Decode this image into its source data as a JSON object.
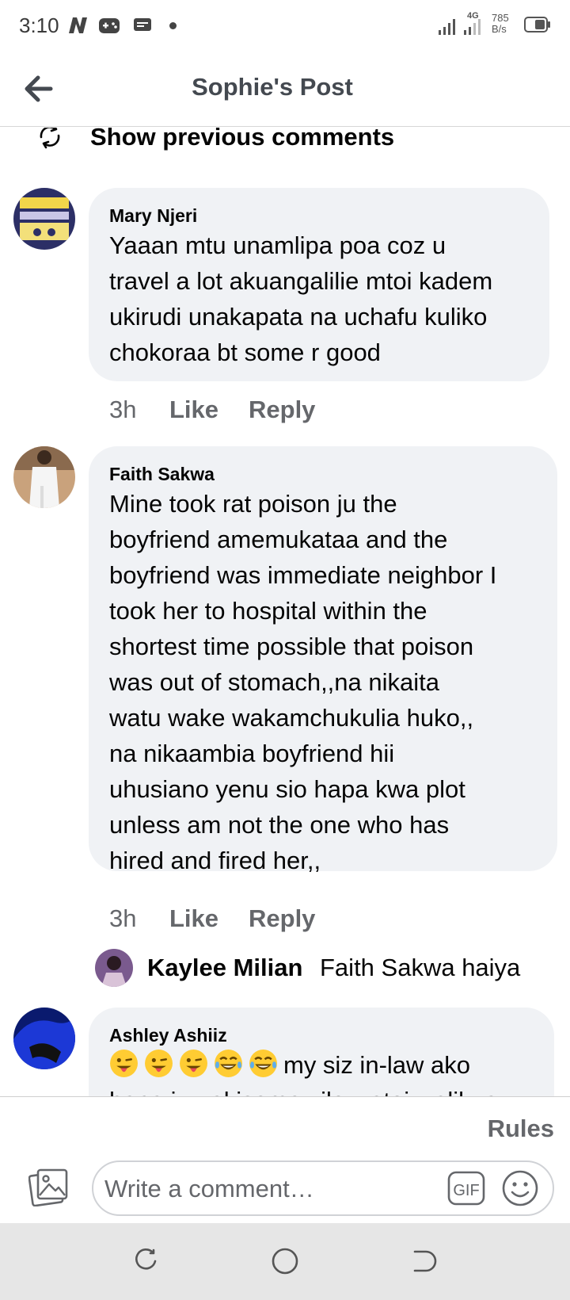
{
  "status_bar": {
    "time": "3:10",
    "network_label": "4G",
    "speed_value": "785",
    "speed_unit": "B/s",
    "icons": [
      "netflix-n-icon",
      "gamepad-icon",
      "message-icon",
      "dot-icon",
      "signal-icon",
      "signal-icon",
      "battery-icon"
    ]
  },
  "header": {
    "title": "Sophie's Post",
    "back_icon": "back-arrow-icon"
  },
  "show_previous": {
    "label": "Show previous comments",
    "icon": "refresh-icon"
  },
  "comments": [
    {
      "author": "Mary Njeri",
      "lines": [
        "Yaaan mtu unamlipa poa coz u",
        "travel a lot akuangalilie mtoi kadem",
        "ukirudi unakapata na uchafu kuliko",
        "chokoraa bt some r good"
      ],
      "time": "3h",
      "like": "Like",
      "reply": "Reply"
    },
    {
      "author": "Faith Sakwa",
      "lines": [
        "Mine took rat poison ju the",
        "boyfriend amemukataa and the",
        "boyfriend was immediate neighbor I",
        "took her to hospital within the",
        "shortest time possible that poison",
        "was out of stomach,,na nikaita",
        "watu wake  wakamchukulia huko,,",
        "na nikaambia boyfriend hii",
        "uhusiano yenu sio hapa kwa plot",
        "unless am not the one who has",
        "hired and fired her,,"
      ],
      "time": "3h",
      "like": "Like",
      "reply": "Reply",
      "reply_preview": {
        "author": "Kaylee Milian",
        "text": "Faith Sakwa haiya"
      }
    },
    {
      "author": "Ashley Ashiiz",
      "emojis": [
        "tongue-wink-emoji",
        "tongue-wink-emoji",
        "tongue-wink-emoji",
        "tears-of-joy-emoji",
        "tears-of-joy-emoji"
      ],
      "lines": [
        "my siz in-law ako",
        "hapa juu akisema vile watoi walikua"
      ]
    }
  ],
  "composer": {
    "rules_label": "Rules",
    "placeholder": "Write a comment…",
    "gif_label": "GIF",
    "photo_icon": "photo-icon",
    "emoji_icon": "emoji-smile-icon"
  },
  "nav": {
    "icons": [
      "recent-apps-icon",
      "home-icon",
      "back-icon"
    ]
  },
  "colors": {
    "bubble": "#f0f2f5",
    "secondary_text": "#65676b",
    "primary_text": "#050505"
  }
}
